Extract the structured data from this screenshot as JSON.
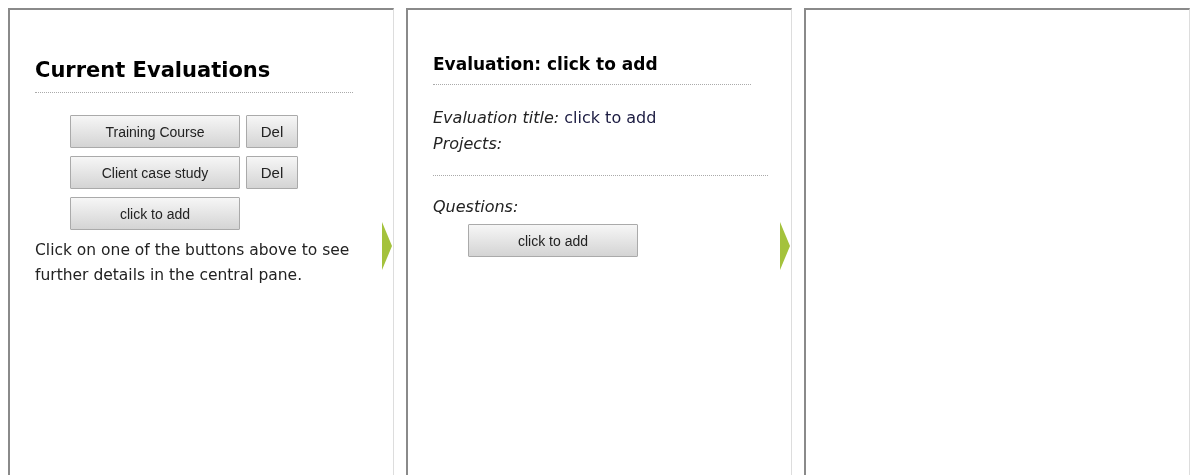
{
  "evaluations_pane": {
    "title": "Current Evaluations",
    "evaluations": [
      {
        "label": "Training Course",
        "delete": "Del"
      },
      {
        "label": "Client case study",
        "delete": "Del"
      }
    ],
    "add_button": "click to add",
    "hint": "Click on one of the buttons above to see further details in the central pane."
  },
  "details_pane": {
    "title": "Evaluation: click to add",
    "title_label": "Evaluation title:",
    "title_value": "click to add",
    "projects_label": "Projects:",
    "questions_label": "Questions:",
    "add_button": "click to add"
  }
}
